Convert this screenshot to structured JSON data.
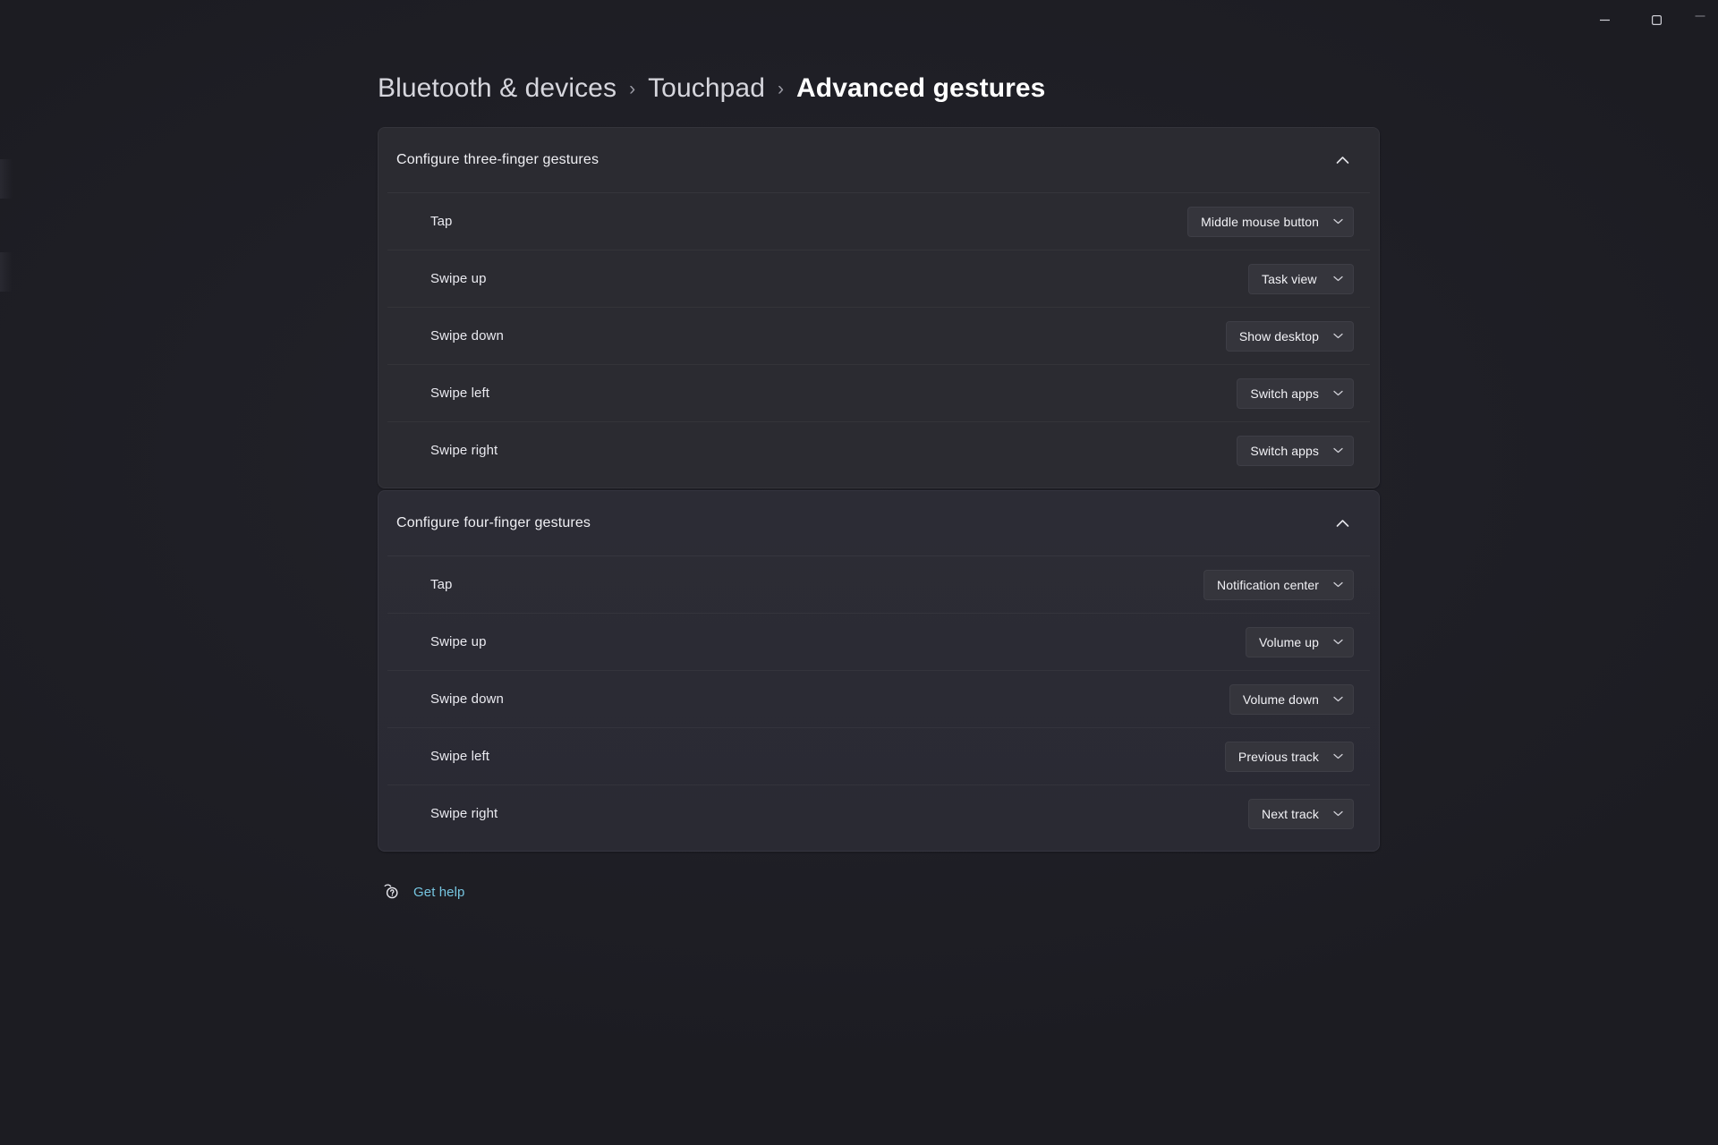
{
  "window": {
    "controls": [
      {
        "name": "minimize-button",
        "icon": "minimize-icon",
        "label": "Minimize"
      },
      {
        "name": "maximize-button",
        "icon": "maximize-icon",
        "label": "Maximize"
      }
    ]
  },
  "breadcrumb": {
    "items": [
      {
        "label": "Bluetooth & devices"
      },
      {
        "label": "Touchpad"
      }
    ],
    "separator": "›",
    "current": "Advanced gestures"
  },
  "sections": [
    {
      "id": "three-finger",
      "title": "Configure three-finger gestures",
      "expanded": true,
      "chevron": "chevron-up-icon",
      "rows": [
        {
          "label": "Tap",
          "value": "Middle mouse button"
        },
        {
          "label": "Swipe up",
          "value": "Task view"
        },
        {
          "label": "Swipe down",
          "value": "Show desktop"
        },
        {
          "label": "Swipe left",
          "value": "Switch apps"
        },
        {
          "label": "Swipe right",
          "value": "Switch apps"
        }
      ]
    },
    {
      "id": "four-finger",
      "title": "Configure four-finger gestures",
      "expanded": true,
      "chevron": "chevron-up-icon",
      "rows": [
        {
          "label": "Tap",
          "value": "Notification center"
        },
        {
          "label": "Swipe up",
          "value": "Volume up"
        },
        {
          "label": "Swipe down",
          "value": "Volume down"
        },
        {
          "label": "Swipe left",
          "value": "Previous track"
        },
        {
          "label": "Swipe right",
          "value": "Next track"
        }
      ]
    }
  ],
  "get_help": {
    "label": "Get help",
    "icon": "help-question-icon"
  },
  "colors": {
    "page_background": "#1e1e24",
    "card_background": "#2b2b31",
    "card_background_alt": "#2c2c35",
    "dropdown_background": "#35353c",
    "text_primary": "#ffffff",
    "text_secondary": "#d6d6dd",
    "accent_link": "#76c5e0"
  }
}
